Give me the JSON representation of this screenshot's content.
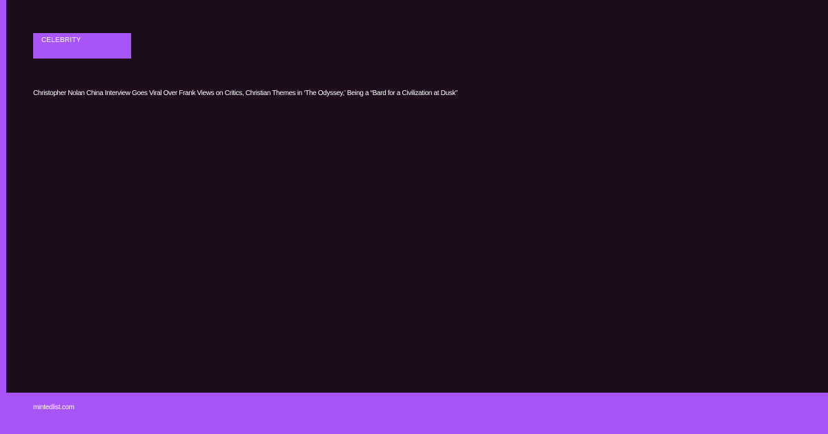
{
  "card": {
    "category": "CELEBRITY",
    "headline": "Christopher Nolan China Interview Goes Viral Over Frank Views on Critics, Christian Themes in ‘The Odyssey,’ Being a “Bard for a Civilization at Dusk”"
  },
  "footer": {
    "site": "mintedlist.com"
  },
  "colors": {
    "accent": "#a855f7",
    "card_background": "#1c0c1c",
    "text": "#ffffff"
  }
}
